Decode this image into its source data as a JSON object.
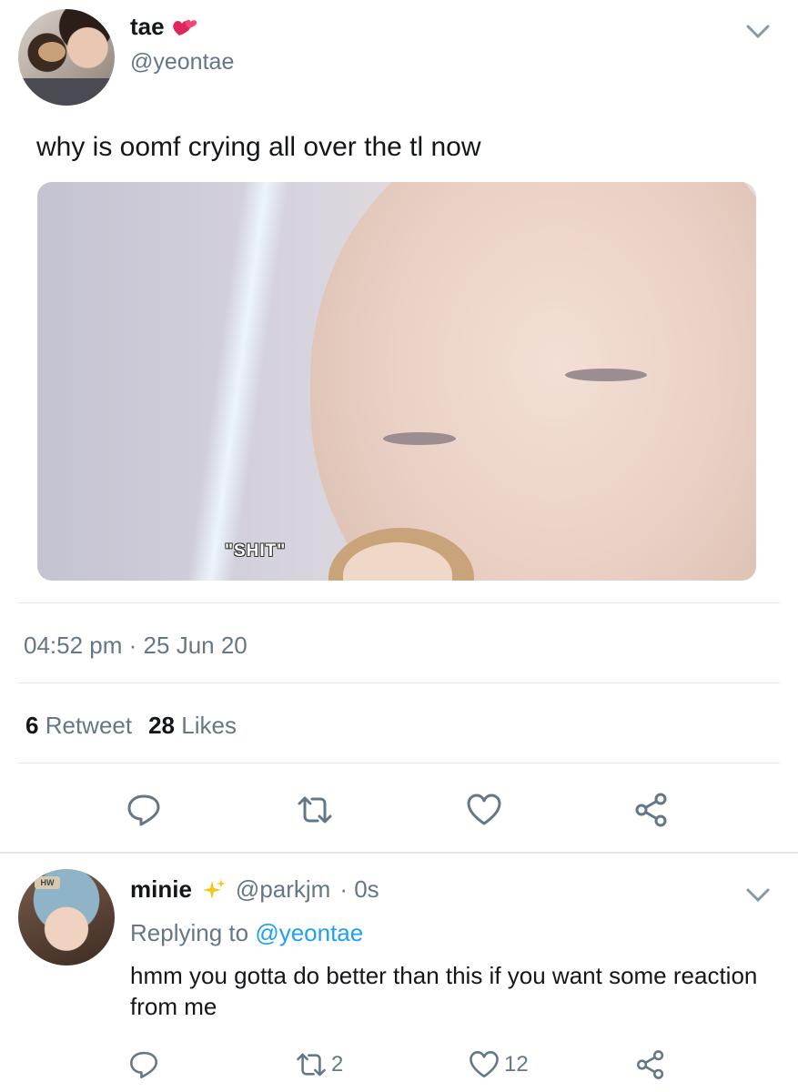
{
  "main_tweet": {
    "display_name": "tae",
    "handle": "@yeontae",
    "text": "why is oomf crying all over the tl now",
    "media": {
      "subtitle": "\"SHIT\""
    },
    "time": "04:52 pm",
    "separator": "·",
    "date": "25 Jun 20",
    "retweet_count": "6",
    "retweet_label": "Retweet",
    "like_count": "28",
    "like_label": "Likes",
    "actions": [
      "reply-icon",
      "retweet-icon",
      "like-icon",
      "share-icon"
    ]
  },
  "reply": {
    "display_name": "minie",
    "handle": "@parkjm",
    "age": "· 0s",
    "replying_prefix": "Replying to",
    "replying_to": "@yeontae",
    "text": "hmm you gotta do better than this if you want some reaction from me",
    "avatar_badge": "HW",
    "retweet_count": "2",
    "like_count": "12"
  },
  "colors": {
    "accent": "#1da1f2",
    "muted": "#657786",
    "text": "#14171a",
    "divider": "#e1e8ed"
  }
}
